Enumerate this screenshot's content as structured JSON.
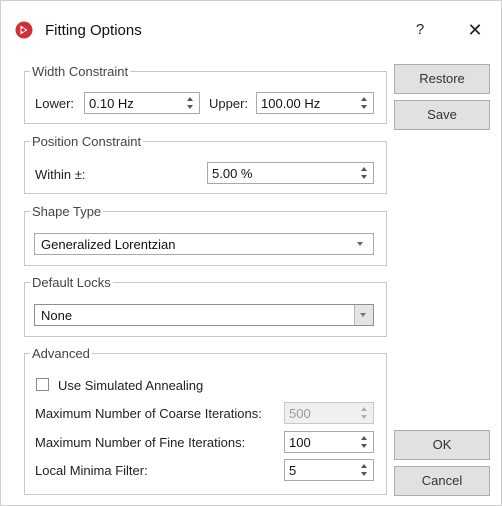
{
  "window": {
    "title": "Fitting Options",
    "help_label": "?",
    "close_label": "✕"
  },
  "width_constraint": {
    "legend": "Width Constraint",
    "lower_label": "Lower:",
    "lower_value": "0.10 Hz",
    "upper_label": "Upper:",
    "upper_value": "100.00 Hz"
  },
  "position_constraint": {
    "legend": "Position Constraint",
    "within_label": "Within ±:",
    "within_value": "5.00 %"
  },
  "shape_type": {
    "legend": "Shape Type",
    "selected": "Generalized Lorentzian"
  },
  "default_locks": {
    "legend": "Default Locks",
    "selected": "None"
  },
  "advanced": {
    "legend": "Advanced",
    "simulated_annealing_label": "Use Simulated Annealing",
    "simulated_annealing_checked": false,
    "coarse_label": "Maximum Number of Coarse Iterations:",
    "coarse_value": "500",
    "fine_label": "Maximum Number of Fine Iterations:",
    "fine_value": "100",
    "minima_label": "Local Minima Filter:",
    "minima_value": "5"
  },
  "buttons": {
    "restore": "Restore",
    "save": "Save",
    "ok": "OK",
    "cancel": "Cancel"
  },
  "colors": {
    "app_icon": "#d0303a",
    "group_border": "#c8c8c8",
    "button_face": "#e1e1e1"
  },
  "icons": {
    "app": "app-logo-icon",
    "close": "close-icon"
  }
}
